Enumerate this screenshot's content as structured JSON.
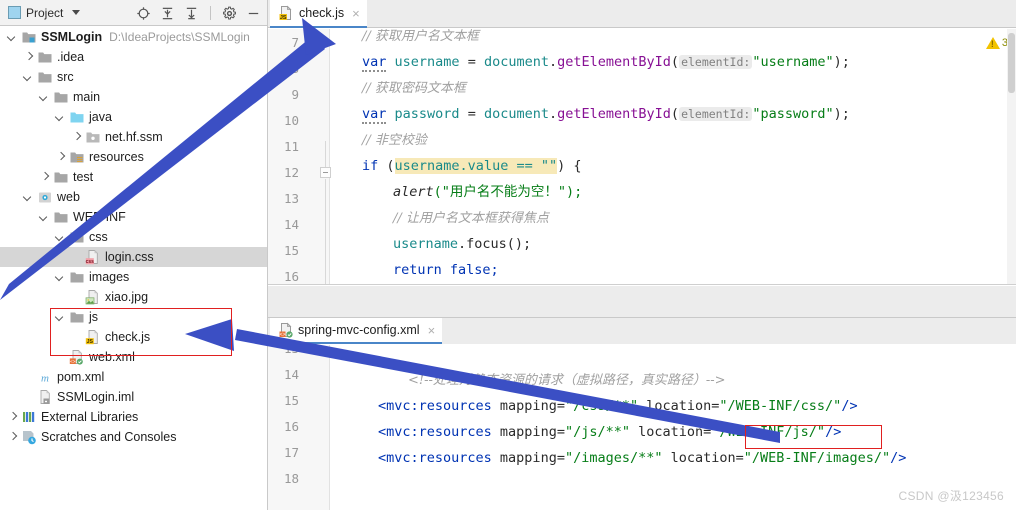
{
  "project_panel": {
    "toolbar": {
      "title": "Project",
      "icons": [
        "project-icon",
        "dropdown-caret",
        "locate-icon",
        "expand-all-icon",
        "collapse-all-icon",
        "settings-gear-icon",
        "hide-panel-icon"
      ]
    },
    "tree": [
      {
        "label": "SSMLogin",
        "path": "D:\\IdeaProjects\\SSMLogin",
        "icon": "module-folder-icon",
        "arrow": "down",
        "indent": 0,
        "bold": true,
        "selected": false
      },
      {
        "label": ".idea",
        "path": "",
        "icon": "folder-icon",
        "arrow": "right",
        "indent": 1,
        "bold": false,
        "selected": false
      },
      {
        "label": "src",
        "path": "",
        "icon": "folder-icon",
        "arrow": "down",
        "indent": 1,
        "bold": false,
        "selected": false
      },
      {
        "label": "main",
        "path": "",
        "icon": "folder-icon",
        "arrow": "down",
        "indent": 2,
        "bold": false,
        "selected": false
      },
      {
        "label": "java",
        "path": "",
        "icon": "source-folder-icon",
        "arrow": "down",
        "indent": 3,
        "bold": false,
        "selected": false
      },
      {
        "label": "net.hf.ssm",
        "path": "",
        "icon": "package-icon",
        "arrow": "right",
        "indent": 4,
        "bold": false,
        "selected": false
      },
      {
        "label": "resources",
        "path": "",
        "icon": "resources-folder-icon",
        "arrow": "right",
        "indent": 3,
        "bold": false,
        "selected": false
      },
      {
        "label": "test",
        "path": "",
        "icon": "folder-icon",
        "arrow": "right",
        "indent": 2,
        "bold": false,
        "selected": false
      },
      {
        "label": "web",
        "path": "",
        "icon": "web-folder-icon",
        "arrow": "down",
        "indent": 1,
        "bold": false,
        "selected": false
      },
      {
        "label": "WEB-INF",
        "path": "",
        "icon": "folder-icon",
        "arrow": "down",
        "indent": 2,
        "bold": false,
        "selected": false
      },
      {
        "label": "css",
        "path": "",
        "icon": "folder-icon",
        "arrow": "down",
        "indent": 3,
        "bold": false,
        "selected": false
      },
      {
        "label": "login.css",
        "path": "",
        "icon": "css-file-icon",
        "arrow": "none",
        "indent": 4,
        "bold": false,
        "selected": true
      },
      {
        "label": "images",
        "path": "",
        "icon": "folder-icon",
        "arrow": "down",
        "indent": 3,
        "bold": false,
        "selected": false
      },
      {
        "label": "xiao.jpg",
        "path": "",
        "icon": "image-file-icon",
        "arrow": "none",
        "indent": 4,
        "bold": false,
        "selected": false
      },
      {
        "label": "js",
        "path": "",
        "icon": "folder-icon",
        "arrow": "down",
        "indent": 3,
        "bold": false,
        "selected": false
      },
      {
        "label": "check.js",
        "path": "",
        "icon": "js-file-icon",
        "arrow": "none",
        "indent": 4,
        "bold": false,
        "selected": false
      },
      {
        "label": "web.xml",
        "path": "",
        "icon": "xml-file-icon",
        "arrow": "none",
        "indent": 3,
        "bold": false,
        "selected": false
      },
      {
        "label": "pom.xml",
        "path": "",
        "icon": "maven-file-icon",
        "arrow": "none",
        "indent": 1,
        "bold": false,
        "selected": false
      },
      {
        "label": "SSMLogin.iml",
        "path": "",
        "icon": "iml-file-icon",
        "arrow": "none",
        "indent": 1,
        "bold": false,
        "selected": false
      },
      {
        "label": "External Libraries",
        "path": "",
        "icon": "libraries-icon",
        "arrow": "right",
        "indent": 0,
        "bold": false,
        "selected": false
      },
      {
        "label": "Scratches and Consoles",
        "path": "",
        "icon": "scratches-icon",
        "arrow": "right",
        "indent": 0,
        "bold": false,
        "selected": false
      }
    ]
  },
  "editor_top": {
    "tab": {
      "label": "check.js",
      "icon": "js-file-icon",
      "close": "×"
    },
    "warning_badge": {
      "icon": "warning-triangle-icon",
      "count": "3"
    },
    "line_numbers": [
      "7",
      "8",
      "9",
      "10",
      "11",
      "12",
      "13",
      "14",
      "15",
      "16"
    ],
    "lines": [
      {
        "num": "7",
        "text": "// 获取用户名文本框"
      },
      {
        "num": "8",
        "text": "var username = document.getElementById( elementId: \"username\");"
      },
      {
        "num": "9",
        "text": "// 获取密码文本框"
      },
      {
        "num": "10",
        "text": "var password = document.getElementById( elementId: \"password\");"
      },
      {
        "num": "11",
        "text": "// 非空校验"
      },
      {
        "num": "12",
        "text": "if (username.value == \"\") {"
      },
      {
        "num": "13",
        "text": "    alert(\"用户名不能为空！\");"
      },
      {
        "num": "14",
        "text": "    // 让用户名文本框获得焦点"
      },
      {
        "num": "15",
        "text": "    username.focus();"
      },
      {
        "num": "16",
        "text": "    return false;"
      }
    ],
    "tokens": {
      "c7": "// 获取用户名文本框",
      "kw_var": "var",
      "id_username": "username",
      "eq": " = ",
      "doc": "document",
      "dot": ".",
      "getel": "getElementById",
      "paren_open": "(",
      "hint_elementid": "elementId:",
      "str_username": "\"username\"",
      "tail": ");",
      "c9": "// 获取密码文本框",
      "id_password": "password",
      "str_password": "\"password\"",
      "c11": "// 非空校验",
      "kw_if": "if",
      "if_open": " (",
      "hl_expr": "username.value == \"\"",
      "if_close": ") {",
      "fn_alert": "alert",
      "alert_arg": "(\"用户名不能为空！\");",
      "c14": "// 让用户名文本框获得焦点",
      "focus_obj": "username",
      "focus_call": ".focus();",
      "kw_return": "return",
      "kw_false": " false;"
    }
  },
  "editor_bottom": {
    "tab": {
      "label": "spring-mvc-config.xml",
      "icon": "xml-file-icon",
      "close": "×"
    },
    "line_numbers": [
      "13",
      "14",
      "15",
      "16",
      "17",
      "18"
    ],
    "lines": [
      {
        "num": "13",
        "text": ""
      },
      {
        "num": "14",
        "text": "<!--处理对静态资源的请求（虚拟路径，真实路径）-->"
      },
      {
        "num": "15",
        "text": "<mvc:resources mapping=\"/css/**\" location=\"/WEB-INF/css/\"/>"
      },
      {
        "num": "16",
        "text": "<mvc:resources mapping=\"/js/**\" location=\"/WEB-INF/js/\"/>"
      },
      {
        "num": "17",
        "text": "<mvc:resources mapping=\"/images/**\" location=\"/WEB-INF/images/\"/>"
      },
      {
        "num": "18",
        "text": ""
      }
    ],
    "tokens": {
      "comment14": "<!--处理对静态资源的请求（虚拟路径，真实路径）-->",
      "tag_open": "<mvc:resources",
      "attr_mapping": " mapping=",
      "val_css": "\"/css/**\"",
      "val_js": "\"/js/**\"",
      "val_images": "\"/images/**\"",
      "attr_location": " location=",
      "loc_css": "\"/WEB-INF/css/\"",
      "loc_js": "\"/WEB-INF/js/\"",
      "loc_images": "\"/WEB-INF/images/\"",
      "tag_close": "/>"
    }
  },
  "annotations": {
    "red_box_color": "#e02020",
    "arrow_color": "#3b4fc4",
    "boxes": [
      {
        "name": "js-folder-highlight-box"
      },
      {
        "name": "js-location-highlight-box"
      }
    ],
    "arrows": [
      {
        "name": "arrow-to-checkjs-tab"
      },
      {
        "name": "arrow-to-js-folder"
      }
    ]
  },
  "watermark": {
    "text": "CSDN @汲123456",
    "color": "#c8c8c8"
  }
}
